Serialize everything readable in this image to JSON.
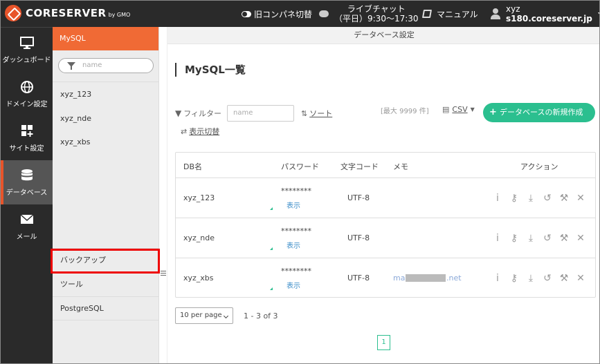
{
  "topbar": {
    "logo_text": "CORESERVER",
    "logo_sub": "by GMO",
    "old_panel_label": "旧コンパネ切替",
    "chat_label": "ライブチャット",
    "chat_hours": "（平日）9:30〜17:30",
    "manual_label": "マニュアル",
    "user_name": "xyz",
    "user_host": "s180.coreserver.jp"
  },
  "leftnav": {
    "items": [
      {
        "label": "ダッシュボード",
        "icon": "monitor-icon"
      },
      {
        "label": "ドメイン設定",
        "icon": "globe-icon"
      },
      {
        "label": "サイト設定",
        "icon": "grid-plus-icon"
      },
      {
        "label": "データベース",
        "icon": "database-icon",
        "active": true
      },
      {
        "label": "メール",
        "icon": "envelope-icon"
      }
    ]
  },
  "sub": {
    "title": "MySQL",
    "search_placeholder": "name",
    "databases": [
      "xyz_123",
      "xyz_nde",
      "xyz_xbs"
    ],
    "bottom_items": [
      "バックアップ",
      "ツール",
      "PostgreSQL"
    ]
  },
  "main": {
    "header": "データベース設定",
    "title": "MySQL一覧",
    "filter_label": "フィルター",
    "filter_placeholder": "name",
    "sort_label": "ソート",
    "max_label": "[最大 9999 件]",
    "csv_label": "CSV",
    "create_label": "データベースの新規作成",
    "display_toggle_label": "表示切替",
    "columns": [
      "DB名",
      "パスワード",
      "文字コード",
      "メモ",
      "アクション"
    ],
    "rows": [
      {
        "name": "xyz_123",
        "password": "********",
        "show": "表示",
        "charset": "UTF-8",
        "memo_prefix": "",
        "memo_suffix": ""
      },
      {
        "name": "xyz_nde",
        "password": "********",
        "show": "表示",
        "charset": "UTF-8",
        "memo_prefix": "",
        "memo_suffix": ""
      },
      {
        "name": "xyz_xbs",
        "password": "********",
        "show": "表示",
        "charset": "UTF-8",
        "memo_prefix": "ma",
        "memo_suffix": ".net"
      }
    ],
    "per_page": "10 per page",
    "count_text": "1 - 3 of 3",
    "current_page": "1"
  },
  "colors": {
    "accent": "#f06a35",
    "brand_green": "#2bbf8f",
    "topbar_bg": "#2a2a2a",
    "highlight": "#e00000"
  }
}
